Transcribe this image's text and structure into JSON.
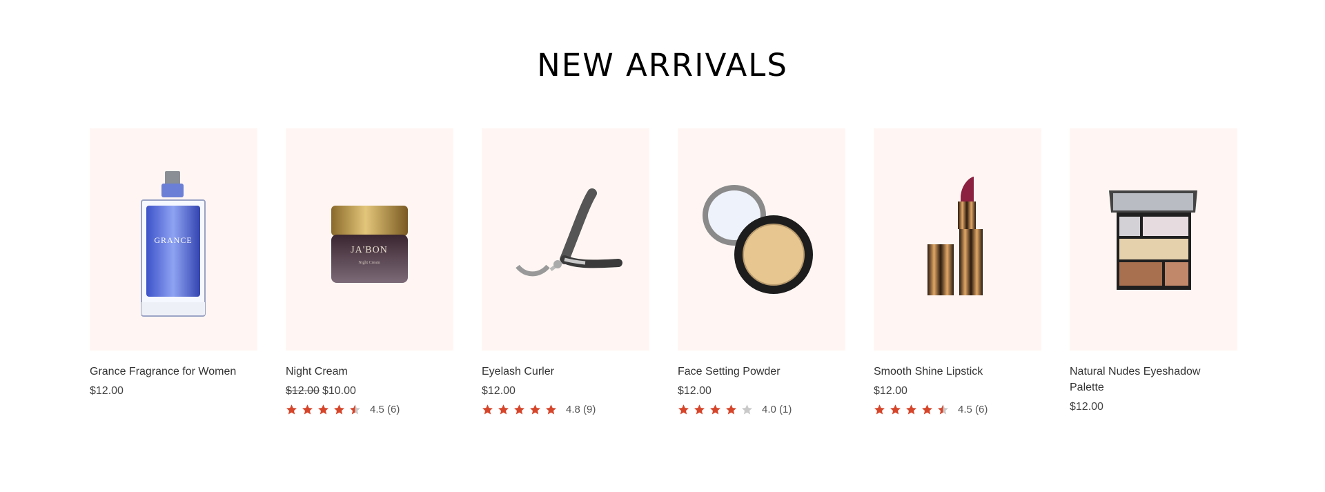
{
  "section": {
    "title": "NEW ARRIVALS"
  },
  "colors": {
    "star_filled": "#d6452a",
    "star_empty": "#c9c9c9",
    "tile_bg": "#fff6f3"
  },
  "products": [
    {
      "name": "Grance Fragrance for Women",
      "price": "$12.00",
      "old_price": null,
      "rating": null,
      "rating_text": "",
      "image_icon": "perfume-bottle-icon"
    },
    {
      "name": "Night Cream",
      "price": "$10.00",
      "old_price": "$12.00",
      "rating": 4.5,
      "rating_text": "4.5 (6)",
      "image_icon": "cream-jar-icon"
    },
    {
      "name": "Eyelash Curler",
      "price": "$12.00",
      "old_price": null,
      "rating": 4.8,
      "rating_text": "4.8 (9)",
      "image_icon": "eyelash-curler-icon"
    },
    {
      "name": "Face Setting Powder",
      "price": "$12.00",
      "old_price": null,
      "rating": 4.0,
      "rating_text": "4.0 (1)",
      "image_icon": "compact-powder-icon"
    },
    {
      "name": "Smooth Shine Lipstick",
      "price": "$12.00",
      "old_price": null,
      "rating": 4.5,
      "rating_text": "4.5 (6)",
      "image_icon": "lipstick-icon"
    },
    {
      "name": "Natural Nudes Eyeshadow Palette",
      "price": "$12.00",
      "old_price": null,
      "rating": null,
      "rating_text": "",
      "image_icon": "eyeshadow-palette-icon"
    }
  ]
}
